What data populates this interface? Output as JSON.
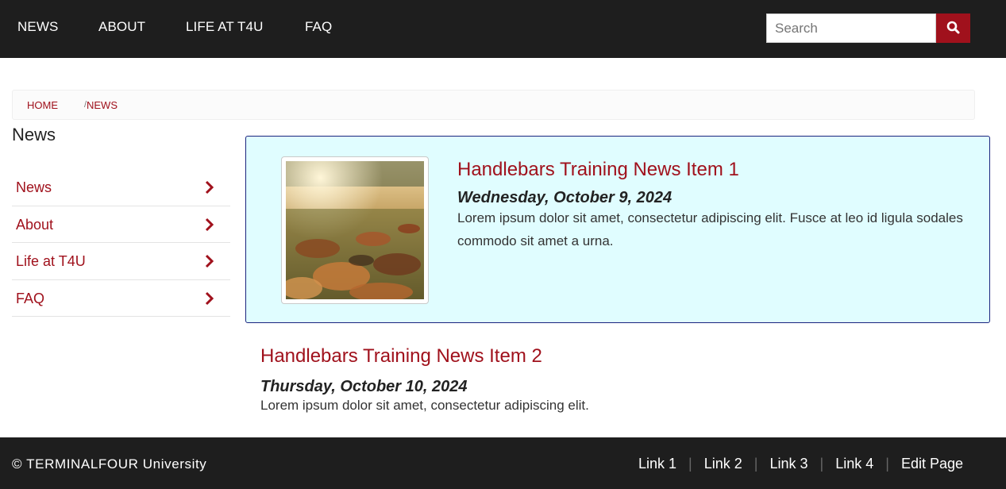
{
  "header": {
    "nav": [
      "NEWS",
      "ABOUT",
      "LIFE AT T4U",
      "FAQ"
    ],
    "search": {
      "placeholder": "Search",
      "button_icon": "search-icon"
    }
  },
  "breadcrumb": {
    "items": [
      "HOME",
      "NEWS"
    ],
    "separator": "/"
  },
  "sidebar": {
    "title": "News",
    "items": [
      {
        "label": "News",
        "icon": "chevron-right-icon"
      },
      {
        "label": "About",
        "icon": "chevron-right-icon"
      },
      {
        "label": "Life at T4U",
        "icon": "chevron-right-icon"
      },
      {
        "label": "FAQ",
        "icon": "chevron-right-icon"
      }
    ]
  },
  "news": [
    {
      "title": "Handlebars Training News Item 1",
      "date": "Wednesday, October 9, 2024",
      "body": "Lorem ipsum dolor sit amet, consectetur adipiscing elit. Fusce at leo id ligula sodales commodo sit amet a urna.",
      "image": "autumn-leaves-photo",
      "highlighted": true
    },
    {
      "title": "Handlebars Training News Item 2",
      "date": "Thursday, October 10, 2024",
      "body": "Lorem ipsum dolor sit amet, consectetur adipiscing elit.",
      "highlighted": false
    }
  ],
  "footer": {
    "copyright": "© TERMINALFOUR University",
    "links": [
      "Link 1",
      "Link 2",
      "Link 3",
      "Link 4",
      "Edit Page"
    ],
    "separator": "|"
  },
  "colors": {
    "accent": "#a0111c",
    "header_bg": "#1e1e1e",
    "card_bg": "#e0fdff",
    "card_border": "#1a237e"
  }
}
